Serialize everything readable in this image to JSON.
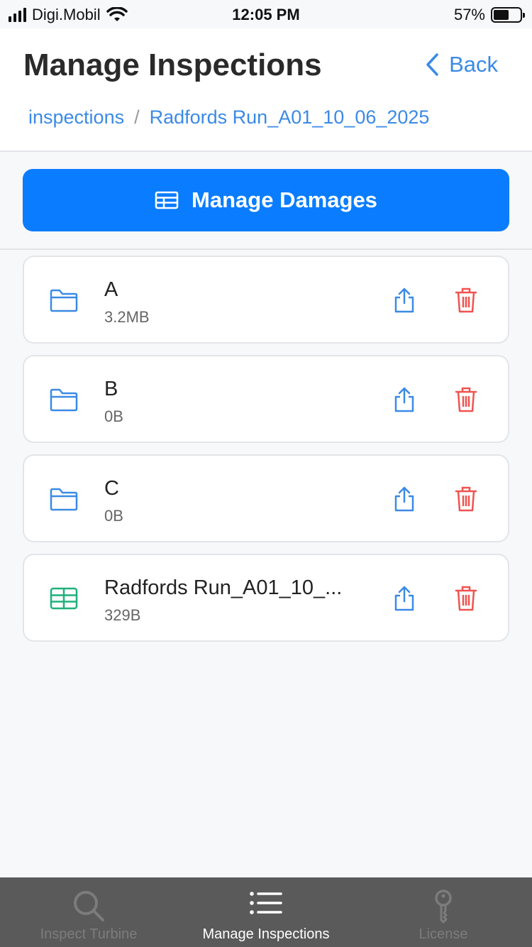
{
  "status_bar": {
    "carrier": "Digi.Mobil",
    "time": "12:05 PM",
    "battery": "57%",
    "battery_level": 0.57
  },
  "header": {
    "title": "Manage Inspections",
    "back_label": "Back",
    "breadcrumb": [
      "inspections",
      "Radfords Run_A01_10_06_2025"
    ],
    "breadcrumb_separator": "/"
  },
  "manage_damages": {
    "label": "Manage Damages",
    "color": "#0a7cff"
  },
  "items": [
    {
      "name": "A",
      "size": "3.2MB",
      "icon": "folder-icon"
    },
    {
      "name": "B",
      "size": "0B",
      "icon": "folder-icon"
    },
    {
      "name": "C",
      "size": "0B",
      "icon": "folder-icon"
    },
    {
      "name": "Radfords Run_A01_10_...",
      "size": "329B",
      "icon": "spreadsheet-icon"
    }
  ],
  "colors": {
    "accent": "#3b8ae6",
    "delete": "#ef5350",
    "spreadsheet": "#1fb07a"
  },
  "tabbar": {
    "tabs": [
      {
        "label": "Inspect Turbine",
        "icon": "search-icon",
        "active": false
      },
      {
        "label": "Manage Inspections",
        "icon": "list-icon",
        "active": true
      },
      {
        "label": "License",
        "icon": "key-icon",
        "active": false
      }
    ]
  }
}
